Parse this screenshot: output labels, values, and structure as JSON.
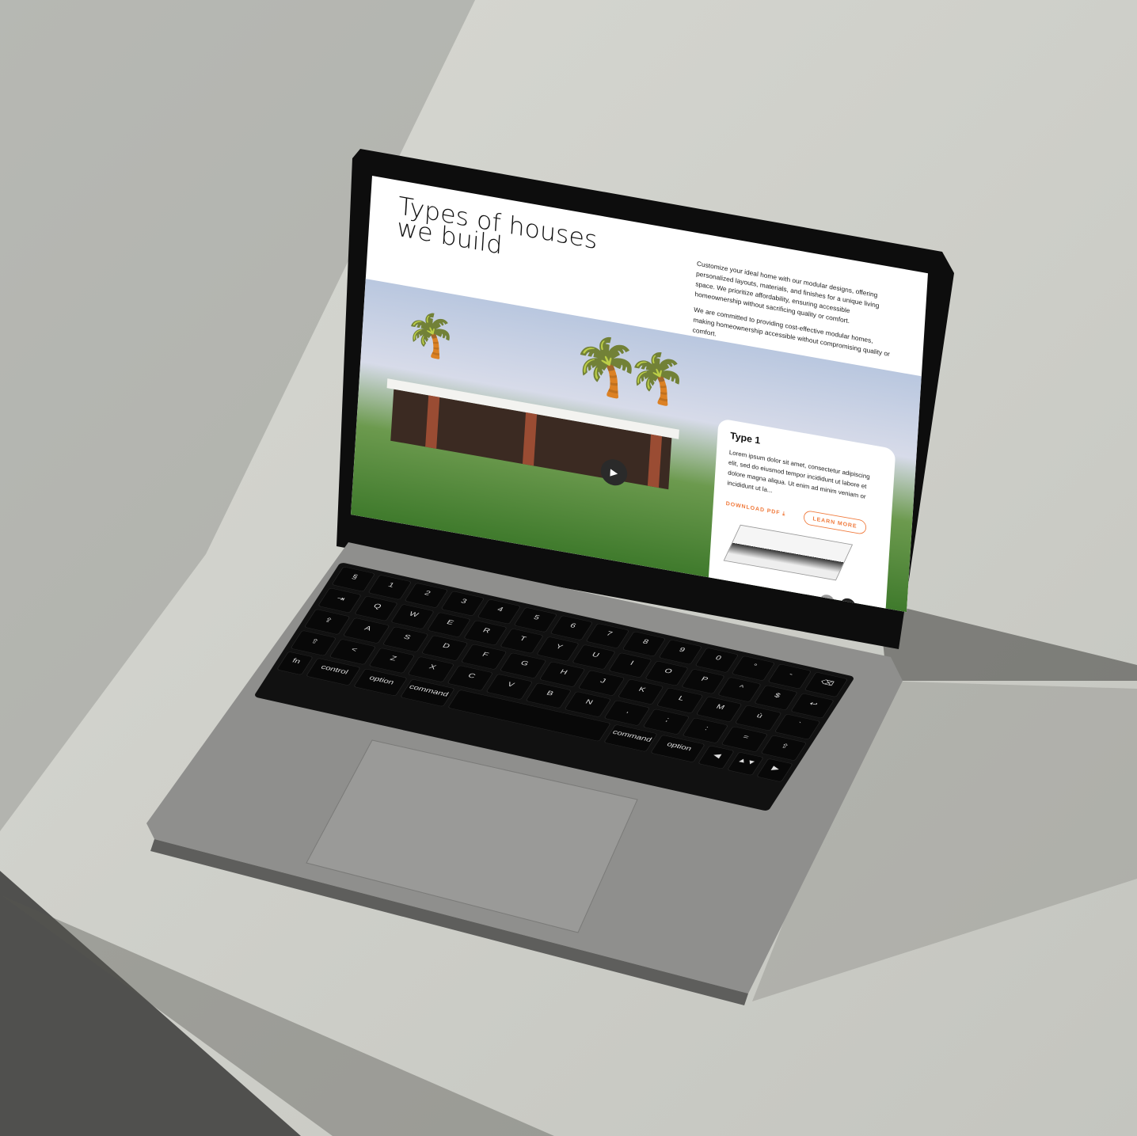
{
  "page": {
    "title": "Types of houses\nwe build",
    "intro": [
      "Customize your ideal home with our modular designs, offering personalized layouts, materials, and finishes for a unique living space. We prioritize affordability, ensuring accessible homeownership without sacrificing quality or comfort.",
      "We are committed to providing cost-effective modular homes, making homeownership accessible without compromising quality or comfort."
    ],
    "play_icon": "play-icon",
    "card": {
      "title": "Type 1",
      "description": "Lorem ipsum dolor sit amet, consectetur adipiscing elit, sed do eiusmod tempor incididunt ut labore et dolore magna aliqua. Ut enim ad minim veniam or incididunt ut la...",
      "download_label": "DOWNLOAD PDF ⤓",
      "learn_more_label": "LEARN MORE",
      "prev": "←",
      "next": "→"
    },
    "accent": "#f07a3c"
  },
  "keyboard": {
    "rows": [
      [
        "§",
        "1",
        "2",
        "3",
        "4",
        "5",
        "6",
        "7",
        "8",
        "9",
        "0",
        "°",
        "-",
        "⌫"
      ],
      [
        "⇥",
        "Q",
        "W",
        "E",
        "R",
        "T",
        "Y",
        "U",
        "I",
        "O",
        "P",
        "^",
        "$",
        "↩"
      ],
      [
        "⇪",
        "A",
        "S",
        "D",
        "F",
        "G",
        "H",
        "J",
        "K",
        "L",
        "M",
        "ù",
        "`"
      ],
      [
        "⇧",
        "<",
        "Z",
        "X",
        "C",
        "V",
        "B",
        "N",
        ",",
        ";",
        ":",
        "=",
        "⇧"
      ],
      [
        "fn",
        "control",
        "option",
        "command",
        "",
        "command",
        "option",
        "◀",
        "▲▼",
        "▶"
      ]
    ]
  }
}
